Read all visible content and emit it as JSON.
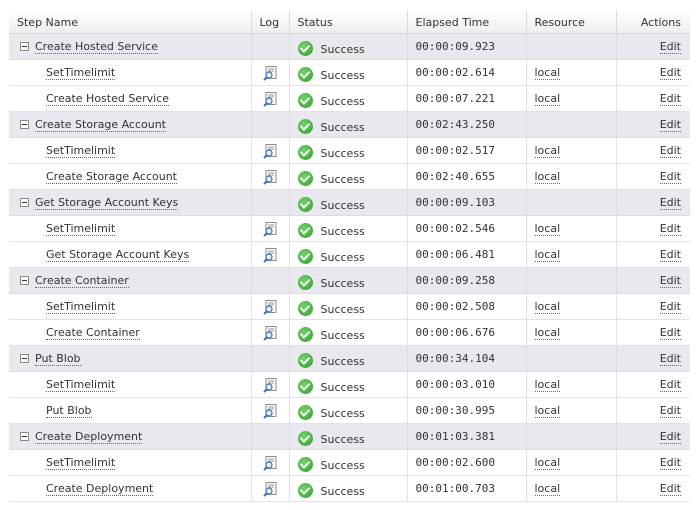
{
  "columns": {
    "step": "Step Name",
    "log": "Log",
    "status": "Status",
    "elapsed": "Elapsed Time",
    "resource": "Resource",
    "actions": "Actions"
  },
  "groups": [
    {
      "name": "Create Hosted Service",
      "status": "Success",
      "elapsed": "00:00:09.923",
      "action": "Edit",
      "children": [
        {
          "name": "SetTimelimit",
          "status": "Success",
          "elapsed": "00:00:02.614",
          "resource": "local",
          "action": "Edit"
        },
        {
          "name": "Create Hosted Service",
          "status": "Success",
          "elapsed": "00:00:07.221",
          "resource": "local",
          "action": "Edit"
        }
      ]
    },
    {
      "name": "Create Storage Account",
      "status": "Success",
      "elapsed": "00:02:43.250",
      "action": "Edit",
      "children": [
        {
          "name": "SetTimelimit",
          "status": "Success",
          "elapsed": "00:00:02.517",
          "resource": "local",
          "action": "Edit"
        },
        {
          "name": "Create Storage Account",
          "status": "Success",
          "elapsed": "00:02:40.655",
          "resource": "local",
          "action": "Edit"
        }
      ]
    },
    {
      "name": "Get Storage Account Keys",
      "status": "Success",
      "elapsed": "00:00:09.103",
      "action": "Edit",
      "children": [
        {
          "name": "SetTimelimit",
          "status": "Success",
          "elapsed": "00:00:02.546",
          "resource": "local",
          "action": "Edit"
        },
        {
          "name": "Get Storage Account Keys",
          "status": "Success",
          "elapsed": "00:00:06.481",
          "resource": "local",
          "action": "Edit"
        }
      ]
    },
    {
      "name": "Create Container",
      "status": "Success",
      "elapsed": "00:00:09.258",
      "action": "Edit",
      "children": [
        {
          "name": "SetTimelimit",
          "status": "Success",
          "elapsed": "00:00:02.508",
          "resource": "local",
          "action": "Edit"
        },
        {
          "name": "Create Container",
          "status": "Success",
          "elapsed": "00:00:06.676",
          "resource": "local",
          "action": "Edit"
        }
      ]
    },
    {
      "name": "Put Blob",
      "status": "Success",
      "elapsed": "00:00:34.104",
      "action": "Edit",
      "children": [
        {
          "name": "SetTimelimit",
          "status": "Success",
          "elapsed": "00:00:03.010",
          "resource": "local",
          "action": "Edit"
        },
        {
          "name": "Put Blob",
          "status": "Success",
          "elapsed": "00:00:30.995",
          "resource": "local",
          "action": "Edit"
        }
      ]
    },
    {
      "name": "Create Deployment",
      "status": "Success",
      "elapsed": "00:01:03.381",
      "action": "Edit",
      "children": [
        {
          "name": "SetTimelimit",
          "status": "Success",
          "elapsed": "00:00:02.600",
          "resource": "local",
          "action": "Edit"
        },
        {
          "name": "Create Deployment",
          "status": "Success",
          "elapsed": "00:01:00.703",
          "resource": "local",
          "action": "Edit"
        }
      ]
    }
  ],
  "icons": {
    "expander": "collapse-minus-icon",
    "log": "log-magnifier-icon",
    "status": "success-check-icon"
  },
  "colors": {
    "group_row_bg": "#e8e8ee",
    "success_green": "#2f9c2a"
  }
}
